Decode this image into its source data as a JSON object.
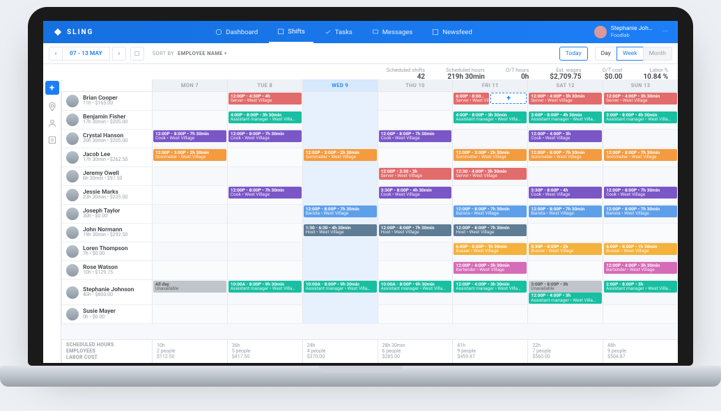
{
  "brand": "SLING",
  "nav": {
    "dashboard": "Dashboard",
    "shifts": "Shifts",
    "tasks": "Tasks",
    "messages": "Messages",
    "newsfeed": "Newsfeed",
    "active": "shifts"
  },
  "user_menu": {
    "name": "Stephanie Joh…",
    "org": "Foodlab"
  },
  "toolbar": {
    "date_range": "07 - 13 MAY",
    "sort_label": "SORT BY",
    "sort_value": "EMPLOYEE NAME",
    "today": "Today",
    "day": "Day",
    "week": "Week",
    "month": "Month"
  },
  "summary": [
    {
      "label": "Scheduled shifts",
      "value": "42"
    },
    {
      "label": "Scheduled hours",
      "value": "219h 30min"
    },
    {
      "label": "O/T hours",
      "value": "0h"
    },
    {
      "label": "Est. wages",
      "value": "$2,709.75"
    },
    {
      "label": "O/T cost",
      "value": "$0.00"
    },
    {
      "label": "Labor %",
      "value": "10.84 %"
    }
  ],
  "days": [
    {
      "label": "MON 7"
    },
    {
      "label": "TUE 8"
    },
    {
      "label": "WED 9",
      "highlight": true
    },
    {
      "label": "THU 10"
    },
    {
      "label": "FRI 11"
    },
    {
      "label": "SAT 12"
    },
    {
      "label": "SUN 13"
    }
  ],
  "employees": [
    {
      "name": "Brian Cooper",
      "meta": "11h • $165.00",
      "shifts": [
        null,
        {
          "c": "red",
          "t": "12:00P - 4:30P • 4h",
          "s": "Server • West Village"
        },
        null,
        null,
        {
          "row": [
            {
              "c": "red",
              "t": "6:00P - 8:00P • 3h…",
              "s": "Server • West Village"
            },
            {
              "c": "outline",
              "t": "+"
            }
          ]
        },
        {
          "c": "red",
          "t": "12:00P - 4:00P • 3h 30min",
          "s": "Server • West Village"
        },
        {
          "c": "red",
          "t": "12:00P - 4:00P • 3h 30min",
          "s": "Server • West Village"
        }
      ]
    },
    {
      "name": "Benjamin Fisher",
      "meta": "17h 30min • $205.00",
      "shifts": [
        null,
        {
          "c": "teal",
          "t": "4:00P - 8:00P • 3h 30min",
          "s": "Assistant manager • West Villa…"
        },
        null,
        null,
        {
          "c": "teal",
          "t": "4:00P - 8:00P • 3h 30min",
          "s": "Assistant manager • West Villa…"
        },
        {
          "c": "teal",
          "t": "3:00P - 8:00P • 4h 30min",
          "s": "Assistant manager • West Villa…"
        },
        {
          "c": "teal",
          "t": "3:00P - 8:00P • 4h 30min",
          "s": "Assistant manager • West Villa…"
        }
      ]
    },
    {
      "name": "Crystal Hanson",
      "meta": "20h 30min • $205.00",
      "shifts": [
        {
          "c": "purple",
          "t": "12:00P - 8:00P • 7h 30min",
          "s": "Cook • West Village"
        },
        {
          "c": "purple",
          "t": "12:00P - 8:00P • 7h 30min",
          "s": "Cook • West Village"
        },
        null,
        {
          "c": "purple",
          "t": "12:00P - 8:00P • 7h 30min",
          "s": "Cook • West Village"
        },
        null,
        {
          "c": "purple",
          "t": "12:00P - 4:00P • 3h",
          "s": "Cook • West Village"
        },
        null
      ]
    },
    {
      "name": "Jacob Lee",
      "meta": "17h 30min • $262.50",
      "shifts": [
        {
          "c": "orange",
          "t": "12:00P - 3:00P • 2h 30min",
          "s": "Sommelier • West Village"
        },
        null,
        {
          "c": "orange",
          "t": "12:00P - 3:00P • 2h 30min",
          "s": "Sommelier • West Village"
        },
        null,
        {
          "c": "orange",
          "t": "12:00P - 3:00P • 2h 30min",
          "s": "Sommelier • West Village"
        },
        {
          "c": "orange",
          "t": "12:00P - 8:00P • 7h 30min",
          "s": "Sommelier • West Village"
        },
        {
          "c": "orange",
          "t": "12:00P - 8:00P • 7h 30min",
          "s": "Sommelier • West Village"
        }
      ]
    },
    {
      "name": "Jeremy Owell",
      "meta": "6h 30min • $97.50",
      "shifts": [
        null,
        null,
        null,
        {
          "c": "red",
          "t": "12:00P - 3:30 • 3h",
          "s": "Server • West Village"
        },
        {
          "c": "red",
          "t": "12:30 - 4:00P • 3h 30min",
          "s": "Server • West Village"
        },
        null,
        null
      ]
    },
    {
      "name": "Jessie Marks",
      "meta": "23h 30min • $235.00",
      "shifts": [
        null,
        {
          "c": "purple",
          "t": "12:00P - 8:00P • 7h 30min",
          "s": "Cook • West Village"
        },
        null,
        {
          "c": "purple",
          "t": "3:30P - 8:00P • 4h 30min",
          "s": "Cook • West Village"
        },
        null,
        {
          "c": "purple",
          "t": "3:30P - 8:00P • 4h",
          "s": "Cook • West Village"
        },
        {
          "c": "purple",
          "t": "12:00P - 8:00P • 7h 30min",
          "s": "Cook • West Village"
        }
      ]
    },
    {
      "name": "Joseph Taylor",
      "meta": "30h • $0.00",
      "shifts": [
        null,
        null,
        {
          "c": "blue",
          "t": "12:00P - 8:00P • 7h 30min",
          "s": "Barista • West Village"
        },
        null,
        {
          "c": "blue",
          "t": "12:00P - 8:00P • 7h 30min",
          "s": "Barista • West Village"
        },
        {
          "c": "blue",
          "t": "12:00P - 8:00P • 7h 30min",
          "s": "Barista • West Village"
        },
        {
          "c": "blue",
          "t": "12:00P - 8:00P • 7h 30min",
          "s": "Barista • West Village"
        }
      ]
    },
    {
      "name": "John Normann",
      "meta": "19h 30min • $292.50",
      "shifts": [
        null,
        null,
        {
          "c": "slate",
          "t": "1:30 - 6:30 • 4h 30min",
          "s": "Host • West Village"
        },
        {
          "c": "slate",
          "t": "12:00P - 8:00P • 7h 30min",
          "s": "Host • West Village"
        },
        {
          "c": "slate",
          "t": "12:00P - 8:00P • 7h 30min",
          "s": "Host • West Village"
        },
        null,
        null
      ]
    },
    {
      "name": "Loren Thompson",
      "meta": "7h • $0.00",
      "shifts": [
        null,
        null,
        null,
        null,
        {
          "c": "yellow",
          "t": "6:00P - 8:00P • 1h 30min",
          "s": "Busser • West Village"
        },
        {
          "c": "yellow",
          "t": "5:30P - 8:00P • 2h",
          "s": "Busser • West Village"
        },
        {
          "c": "yellow",
          "t": "6:00P - 8:00P • 1h 30min",
          "s": "Busser • West Village"
        }
      ]
    },
    {
      "name": "Rose Watson",
      "meta": "10h • $129.75",
      "shifts": [
        null,
        null,
        null,
        null,
        {
          "c": "pink",
          "t": "12:00P - 4:00P • 3h 30min",
          "s": "Bartender • West Village"
        },
        null,
        {
          "c": "pink",
          "t": "12:00P - 4:00P • 3h 30min",
          "s": "Bartender • West Village"
        }
      ]
    },
    {
      "name": "Stephanie Johnson",
      "meta": "40h • $800.00",
      "shifts": [
        {
          "c": "gray",
          "t": "All day",
          "s": "Unavailable"
        },
        {
          "c": "teal",
          "t": "10:00A - 8:00P • 9h 30min",
          "s": "Assistant manager • West Villa…"
        },
        {
          "c": "teal",
          "t": "10:00A - 8:00P • 9h 30min",
          "s": "Assistant manager • West Villa…"
        },
        {
          "c": "teal",
          "t": "10:00A - 8:00P • 9h 30min",
          "s": "Assistant manager • West Villa…"
        },
        {
          "c": "teal",
          "t": "12:00P - 4:00P • 3h 30min",
          "s": "Assistant manager • West Villa…"
        },
        {
          "stack": [
            {
              "c": "gray",
              "t": "3:00P - 8:00P • 3h",
              "s": "Unavailable"
            },
            {
              "c": "teal",
              "t": "12:00P - 4:00P • 3h",
              "s": "Assistant manager • West Villa…"
            }
          ]
        },
        {
          "c": "teal",
          "t": "2:00P - 8:00P • 3h",
          "s": "Assistant manager • West Villa…"
        }
      ]
    },
    {
      "name": "Susie Mayer",
      "meta": "0h • $0.00",
      "shifts": [
        null,
        null,
        null,
        null,
        null,
        null,
        null
      ]
    }
  ],
  "footer": {
    "labels": [
      "SCHEDULED HOURS",
      "EMPLOYEES",
      "LABOR COST"
    ],
    "cols": [
      {
        "hours": "10h",
        "emp": "2 people",
        "cost": "$112.50"
      },
      {
        "hours": "36h",
        "emp": "5 people",
        "cost": "$417.50"
      },
      {
        "hours": "24h",
        "emp": "4 people",
        "cost": "$370.00"
      },
      {
        "hours": "28h 30min",
        "emp": "6 people",
        "cost": "$285.00"
      },
      {
        "hours": "41h",
        "emp": "9 people",
        "cost": "$459.87"
      },
      {
        "hours": "32h",
        "emp": "7 people",
        "cost": "$560.00"
      },
      {
        "hours": "48h",
        "emp": "9 people",
        "cost": "$504.87"
      }
    ]
  }
}
